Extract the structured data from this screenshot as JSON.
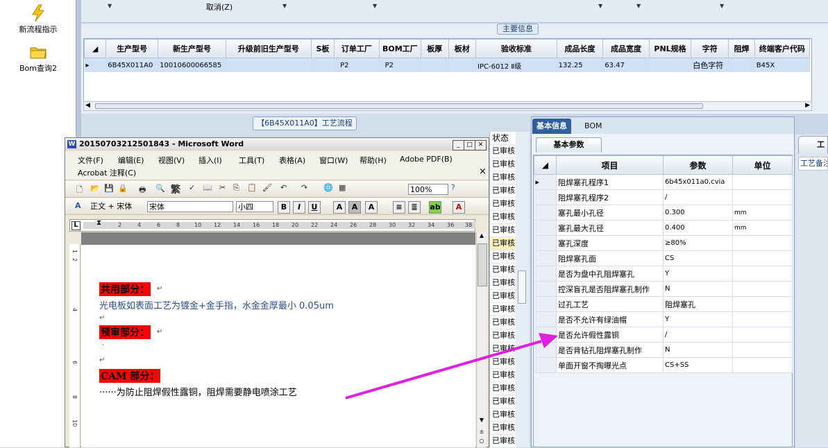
{
  "left_nav": {
    "items": [
      {
        "label": "新流程指示",
        "icon": "lightning-icon"
      },
      {
        "label": "Bom查询2",
        "icon": "folder-icon"
      }
    ]
  },
  "top_bar": {
    "cancel_label": "取消(Z)"
  },
  "main_info": {
    "title": "主要信息",
    "columns": [
      "生产型号",
      "新生产型号",
      "升级前旧生产型号",
      "S板",
      "订单工厂",
      "BOM工厂",
      "板厚",
      "板材",
      "验收标准",
      "成品长度",
      "成品宽度",
      "PNL规格",
      "字符",
      "阻焊",
      "终端客户代码"
    ],
    "row": [
      "6B45X011A0",
      "10010600066585",
      "",
      "",
      "P2",
      "P2",
      "",
      "",
      "IPC-6012 Ⅱ级",
      "132.25",
      "63.47",
      "",
      "白色字符",
      "",
      "B45X"
    ]
  },
  "process_flow": {
    "title": "【6B45X011A0】工艺流程",
    "status_header": "状态",
    "status_rows": [
      "已审核",
      "已审核",
      "已审核",
      "已审核",
      "已审核",
      "已审核",
      "已审核",
      "已审核",
      "已审核",
      "已审核",
      "已审核",
      "已审核",
      "已审核",
      "已审核",
      "已审核",
      "已审核",
      "已审核",
      "已审核",
      "已审核",
      "已审核",
      "已审核",
      "已审核",
      "已审核"
    ]
  },
  "right_panel": {
    "tabs": [
      "基本信息",
      "BOM"
    ],
    "subtab": "基本参数",
    "columns": [
      "项目",
      "参数",
      "单位"
    ],
    "rows": [
      {
        "item": "阻焊塞孔程序1",
        "value": "6b45x011a0.cvia",
        "unit": ""
      },
      {
        "item": "阻焊塞孔程序2",
        "value": "/",
        "unit": ""
      },
      {
        "item": "塞孔最小孔径",
        "value": "0.300",
        "unit": "mm"
      },
      {
        "item": "塞孔最大孔径",
        "value": "0.400",
        "unit": "mm"
      },
      {
        "item": "塞孔深度",
        "value": "≥80%",
        "unit": ""
      },
      {
        "item": "阻焊塞孔面",
        "value": "CS",
        "unit": ""
      },
      {
        "item": "是否为盘中孔阻焊塞孔",
        "value": "Y",
        "unit": ""
      },
      {
        "item": "控深盲孔是否阻焊塞孔制作",
        "value": "N",
        "unit": ""
      },
      {
        "item": "过孔工艺",
        "value": "阻焊塞孔",
        "unit": ""
      },
      {
        "item": "是否不允许有绿油帽",
        "value": "Y",
        "unit": ""
      },
      {
        "item": "是否允许假性露铜",
        "value": "/",
        "unit": ""
      },
      {
        "item": "是否背钻孔阻焊塞孔制作",
        "value": "N",
        "unit": ""
      },
      {
        "item": "单面开窗不掏曝光点",
        "value": "CS+SS",
        "unit": ""
      }
    ],
    "far_tab_label": "工",
    "far_label": "工艺备注"
  },
  "word": {
    "title": "20150703212501843 - Microsoft Word",
    "menu_row1": [
      "文件(F)",
      "编辑(E)",
      "视图(V)",
      "插入(I)",
      "工具(T)",
      "表格(A)",
      "窗口(W)",
      "帮助(H)",
      "Adobe PDF(B)"
    ],
    "menu_row2": [
      "Acrobat 注释(C)"
    ],
    "close_x": "×",
    "zoom": "100%",
    "style": "正文 + 宋体",
    "font": "宋体",
    "size": "小四",
    "trad": "繁",
    "ruler_numbers": [
      "2",
      "4",
      "6",
      "8",
      "10",
      "12",
      "14",
      "16",
      "18",
      "20",
      "22",
      "24",
      "26",
      "28",
      "30",
      "32",
      "34",
      "36",
      "38"
    ],
    "vruler_numbers": [
      "1",
      "2",
      "4",
      "6",
      "8",
      "10"
    ],
    "doc": {
      "h1": "共用部分：",
      "p1": "光电板如表面工艺为镀金+金手指，水金金厚最小 0.05um",
      "h2": "预审部分：",
      "p2": "·",
      "h3": "CAM 部分：",
      "p3": "······为防止阻焊假性露铜，阻焊需要静电喷涂工艺",
      "para_mark": "↵"
    }
  },
  "colors": {
    "highlight": "#ff0000",
    "arrow": "#e020e0",
    "tab_active": "#2f5f9e",
    "selected_row": "#cfe0f7"
  }
}
